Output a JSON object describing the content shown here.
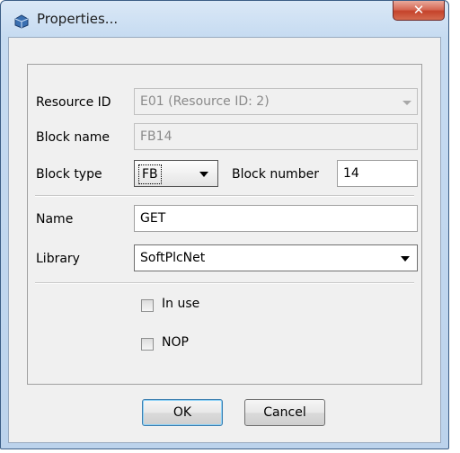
{
  "window": {
    "title": "Properties...",
    "close_label": "✕"
  },
  "form": {
    "resource_id": {
      "label": "Resource ID",
      "value": "E01 (Resource ID: 2)"
    },
    "block_name": {
      "label": "Block name",
      "value": "FB14"
    },
    "block_type": {
      "label": "Block type",
      "value": "FB"
    },
    "block_number": {
      "label": "Block number",
      "value": "14"
    },
    "name": {
      "label": "Name",
      "value": "GET"
    },
    "library": {
      "label": "Library",
      "value": "SoftPlcNet"
    },
    "in_use": {
      "label": "In use",
      "checked": false
    },
    "nop": {
      "label": "NOP",
      "checked": false
    }
  },
  "buttons": {
    "ok": "OK",
    "cancel": "Cancel"
  },
  "colors": {
    "title_bar": "#c6dbf1",
    "close_button": "#c5432b",
    "client_bg": "#f0f0f0"
  }
}
